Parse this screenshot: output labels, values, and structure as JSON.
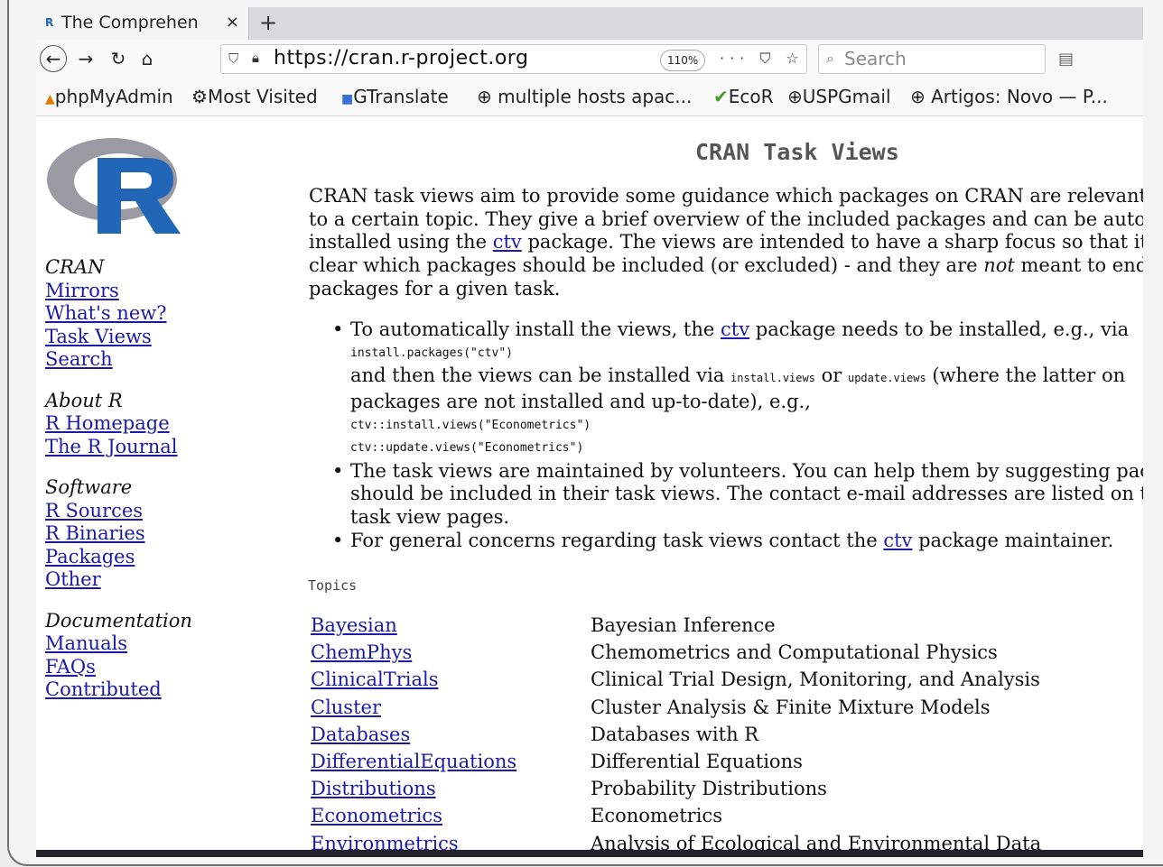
{
  "tab": {
    "title": "The Comprehen",
    "close": "×",
    "new": "+",
    "favicon": "R"
  },
  "nav": {
    "url": "https://cran.r-project.org",
    "zoom": "110%",
    "search_placeholder": "Search",
    "url_actions": "··· ⛉ ☆"
  },
  "bookmarks": [
    "phpMyAdmin",
    "Most Visited",
    "GTranslate",
    "multiple hosts apac...",
    "EcoR",
    "USPGmail",
    "Artigos: Novo — P..."
  ],
  "sidebar": {
    "cran": {
      "heading": "CRAN",
      "links": [
        "Mirrors",
        "What's new?",
        "Task Views",
        "Search"
      ]
    },
    "about": {
      "heading": "About R",
      "links": [
        "R Homepage",
        "The R Journal"
      ]
    },
    "software": {
      "heading": "Software",
      "links": [
        "R Sources",
        "R Binaries",
        "Packages",
        "Other"
      ]
    },
    "docs": {
      "heading": "Documentation",
      "links": [
        "Manuals",
        "FAQs",
        "Contributed"
      ]
    }
  },
  "main": {
    "title": "CRAN Task Views",
    "intro": {
      "l1": "CRAN task views aim to provide some guidance which packages on CRAN are relevant",
      "l2": "to a certain topic. They give a brief overview of the included packages and can be autom",
      "l3a": "installed using the ",
      "l3link": "ctv",
      "l3b": " package. The views are intended to have a sharp focus so that it",
      "l4a": "clear which packages should be included (or excluded) - and they are ",
      "l4em": "not",
      "l4b": " meant to end",
      "l5": "packages for a given task."
    },
    "b1": {
      "a": "To automatically install the views, the ",
      "link": "ctv",
      "b": " package needs to be installed, e.g., via",
      "code1": "install.packages(\"ctv\")",
      "c": "and then the views can be installed via ",
      "code2": "install.views",
      "d": " or ",
      "code3": "update.views",
      "e": " (where the latter on",
      "f": "packages are not installed and up-to-date), e.g.,",
      "code4": "ctv::install.views(\"Econometrics\")",
      "code5": "ctv::update.views(\"Econometrics\")"
    },
    "b2": {
      "l1": "The task views are maintained by volunteers. You can help them by suggesting pac",
      "l2": "should be included in their task views. The contact e-mail addresses are listed on t",
      "l3": "task view pages."
    },
    "b3": {
      "a": "For general concerns regarding task views contact the ",
      "link": "ctv",
      "b": " package maintainer."
    },
    "topics_heading": "Topics",
    "topics": [
      {
        "name": "Bayesian",
        "desc": "Bayesian Inference"
      },
      {
        "name": "ChemPhys",
        "desc": "Chemometrics and Computational Physics"
      },
      {
        "name": "ClinicalTrials",
        "desc": "Clinical Trial Design, Monitoring, and Analysis"
      },
      {
        "name": "Cluster",
        "desc": "Cluster Analysis & Finite Mixture Models"
      },
      {
        "name": "Databases",
        "desc": "Databases with R"
      },
      {
        "name": "DifferentialEquations",
        "desc": "Differential Equations"
      },
      {
        "name": "Distributions",
        "desc": "Probability Distributions"
      },
      {
        "name": "Econometrics",
        "desc": "Econometrics"
      },
      {
        "name": "Environmetrics",
        "desc": "Analysis of Ecological and Environmental Data"
      }
    ]
  },
  "colors": {
    "link": "#1a1aa6",
    "logo_blue": "#2266b8",
    "logo_gray": "#9a9aa2"
  }
}
